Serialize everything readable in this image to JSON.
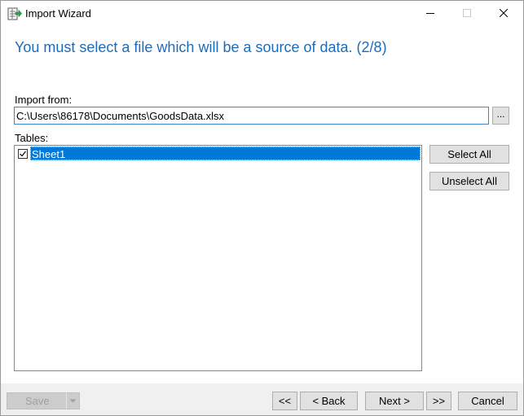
{
  "window": {
    "title": "Import Wizard"
  },
  "heading": "You must select a file which will be a source of data. (2/8)",
  "import_from": {
    "label": "Import from:",
    "value": "C:\\Users\\86178\\Documents\\GoodsData.xlsx",
    "browse_label": "..."
  },
  "tables": {
    "label": "Tables:",
    "items": [
      {
        "name": "Sheet1",
        "checked": true,
        "selected": true
      }
    ],
    "select_all_label": "Select All",
    "unselect_all_label": "Unselect All"
  },
  "footer": {
    "save_label": "Save",
    "first_label": "<<",
    "back_label": "< Back",
    "next_label": "Next >",
    "last_label": ">>",
    "cancel_label": "Cancel"
  },
  "colors": {
    "heading": "#1e6bb8",
    "selection": "#0078d7",
    "input_focus_border": "#3d85d1"
  },
  "icons": {
    "app": "import-wizard-icon",
    "minimize": "minimize-icon",
    "maximize": "maximize-icon",
    "close": "close-icon",
    "checkbox": "checkmark-icon",
    "dropdown": "chevron-down-icon"
  }
}
